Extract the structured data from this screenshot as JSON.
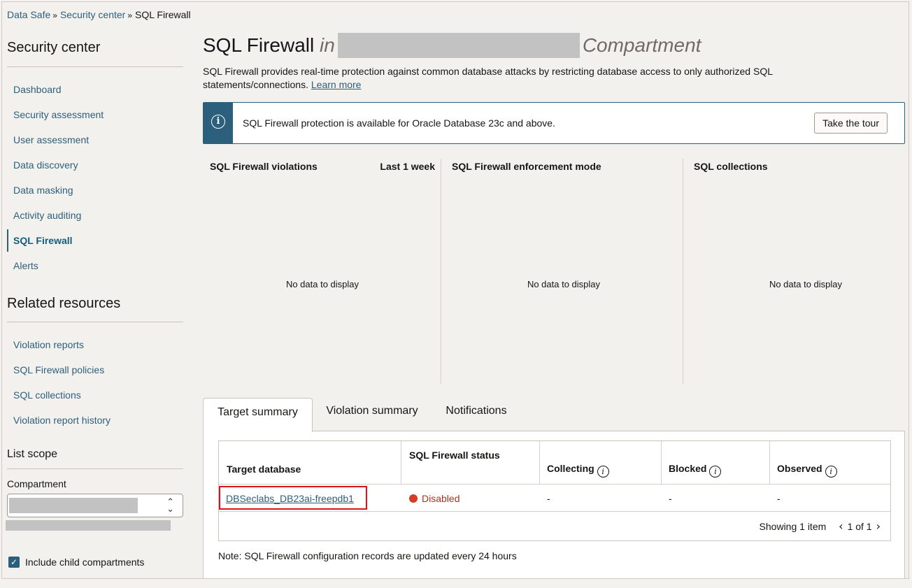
{
  "breadcrumb": {
    "items": [
      "Data Safe",
      "Security center"
    ],
    "current": "SQL Firewall"
  },
  "sidebar": {
    "heading": "Security center",
    "items": [
      {
        "label": "Dashboard"
      },
      {
        "label": "Security assessment"
      },
      {
        "label": "User assessment"
      },
      {
        "label": "Data discovery"
      },
      {
        "label": "Data masking"
      },
      {
        "label": "Activity auditing"
      },
      {
        "label": "SQL Firewall",
        "active": true
      },
      {
        "label": "Alerts"
      }
    ],
    "related_heading": "Related resources",
    "related_items": [
      {
        "label": "Violation reports"
      },
      {
        "label": "SQL Firewall policies"
      },
      {
        "label": "SQL collections"
      },
      {
        "label": "Violation report history"
      }
    ],
    "scope_heading": "List scope",
    "compartment_label": "Compartment",
    "include_child_label": "Include child compartments",
    "include_child_checked": true
  },
  "main": {
    "title": "SQL Firewall",
    "title_in": "in",
    "title_compartment": "Compartment",
    "description": "SQL Firewall provides real-time protection against common database attacks by restricting database access to only authorized SQL statements/connections.",
    "learn_more": "Learn more",
    "info_message": "SQL Firewall protection is available for Oracle Database 23c and above.",
    "tour_button": "Take the tour",
    "panels": [
      {
        "title": "SQL Firewall violations",
        "range": "Last 1 week",
        "empty": "No data to display"
      },
      {
        "title": "SQL Firewall enforcement mode",
        "empty": "No data to display"
      },
      {
        "title": "SQL collections",
        "empty": "No data to display"
      }
    ],
    "tabs": [
      {
        "label": "Target summary",
        "active": true
      },
      {
        "label": "Violation summary"
      },
      {
        "label": "Notifications"
      }
    ],
    "table": {
      "headers": {
        "target": "Target database",
        "status": "SQL Firewall status",
        "collecting": "Collecting",
        "blocked": "Blocked",
        "observed": "Observed"
      },
      "rows": [
        {
          "target": "DBSeclabs_DB23ai-freepdb1",
          "status": "Disabled",
          "collecting": "-",
          "blocked": "-",
          "observed": "-"
        }
      ],
      "showing": "Showing 1 item",
      "page": "1 of 1"
    },
    "note": "Note: SQL Firewall configuration records are updated every 24 hours"
  },
  "colors": {
    "accent": "#2c5f7c",
    "status_disabled": "#d63b25",
    "highlight": "#d9131b"
  }
}
